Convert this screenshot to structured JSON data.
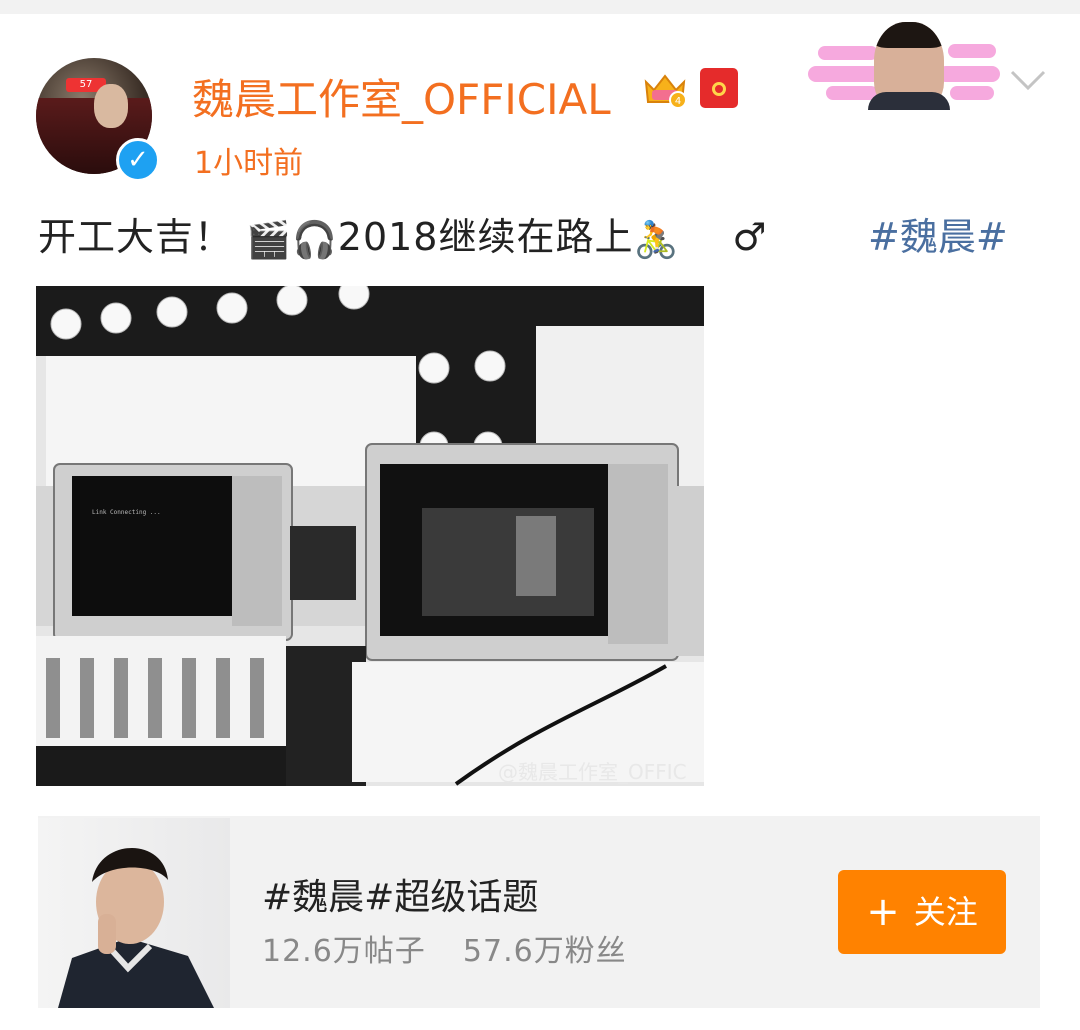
{
  "post": {
    "username": "魏晨工作室_OFFICIAL",
    "timestamp": "1小时前",
    "verified_mark": "✓",
    "text": "开工大吉！",
    "text_after_emoji": "2018继续在路上",
    "symbol": "♂",
    "hashtag": "#魏晨#",
    "emojis": [
      "clapperboard-icon",
      "headphones-icon",
      "bicyclist-icon"
    ],
    "image_watermark": "@魏晨工作室_OFFIC"
  },
  "topic_card": {
    "title": "#魏晨#超级话题",
    "posts_count": "12.6万帖子",
    "fans_count": "57.6万粉丝",
    "follow_label": "关注",
    "follow_plus": "+"
  },
  "colors": {
    "username": "#f36f20",
    "hashtag": "#4a6fa0",
    "follow_button": "#ff8200",
    "card_background": "#f2f2f2"
  }
}
